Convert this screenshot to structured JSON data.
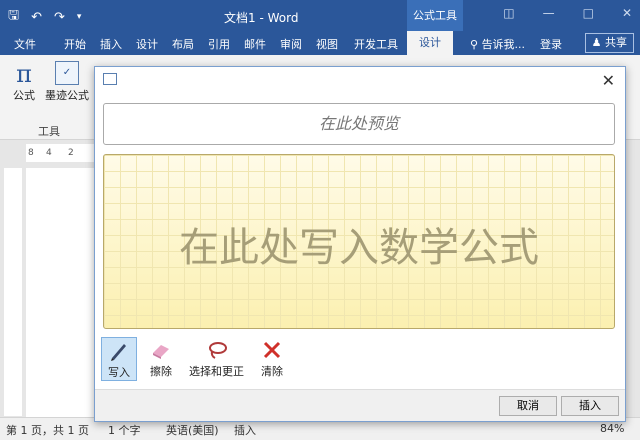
{
  "window": {
    "title": "文档1 - Word",
    "contextual_tab": "公式工具"
  },
  "tabs": [
    "文件",
    "开始",
    "插入",
    "设计",
    "布局",
    "引用",
    "邮件",
    "审阅",
    "视图",
    "开发工具"
  ],
  "active_tab": "设计",
  "tell_me": "告诉我...",
  "login": "登录",
  "share": "共享",
  "ribbon": {
    "equation_label": "公式",
    "ink_equation_label": "墨迹公式",
    "group_label": "工具"
  },
  "ruler_marks": [
    "8",
    "4",
    "2"
  ],
  "dialog": {
    "preview_placeholder": "在此处预览",
    "write_placeholder": "在此处写入数学公式",
    "tools": [
      {
        "label": "写入",
        "icon": "pen-icon"
      },
      {
        "label": "擦除",
        "icon": "eraser-icon"
      },
      {
        "label": "选择和更正",
        "icon": "lasso-icon"
      },
      {
        "label": "清除",
        "icon": "clear-icon"
      }
    ],
    "cancel": "取消",
    "insert": "插入"
  },
  "status": {
    "page": "第 1 页，共 1 页",
    "words": "1 个字",
    "lang": "英语(美国)",
    "mode": "插入",
    "zoom": "84%"
  },
  "colors": {
    "accent": "#2b579a",
    "pad": "#fff9d6"
  }
}
